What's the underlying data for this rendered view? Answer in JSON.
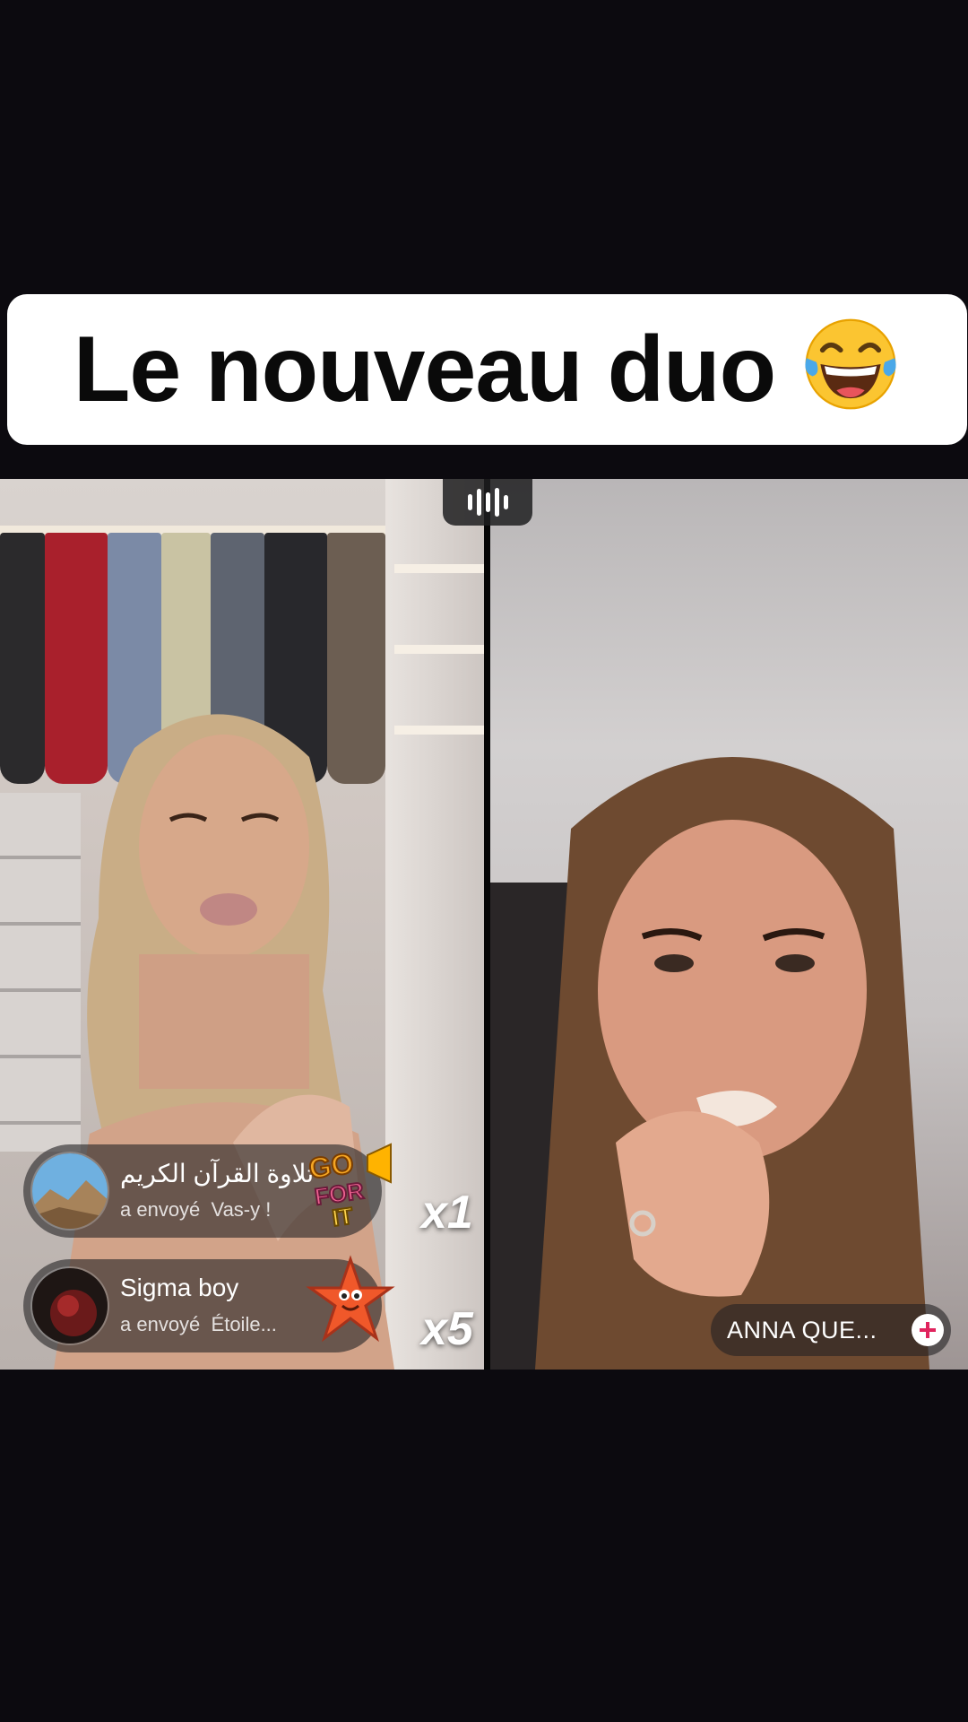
{
  "caption": {
    "text": "Le nouveau duo",
    "emoji": "face-with-tears-of-joy"
  },
  "audio_indicator": {
    "icon": "sound-wave-icon"
  },
  "gifts": [
    {
      "sender": "تلاوة القرآن الكريم",
      "sent_label": "a envoyé",
      "gift_name": "Vas-y !",
      "gift_icon": "go-for-it-sticker",
      "count": "x1"
    },
    {
      "sender": "Sigma boy",
      "sent_label": "a envoyé",
      "gift_name": "Étoile...",
      "gift_icon": "starfish-icon",
      "count": "x5"
    }
  ],
  "right_host": {
    "name": "ANNA QUE...",
    "follow_icon": "plus-icon"
  },
  "colors": {
    "background": "#0c0a0f",
    "caption_bg": "#ffffff",
    "follow_plus": "#e0245e"
  }
}
